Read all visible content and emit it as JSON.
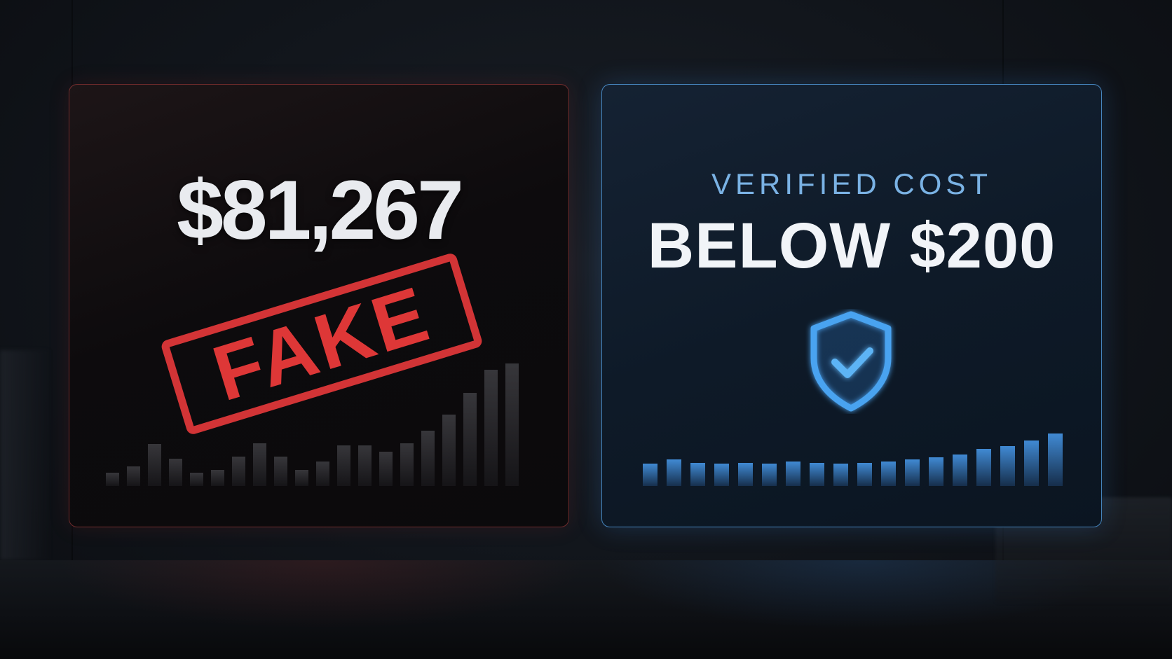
{
  "left_panel": {
    "amount": "$81,267",
    "stamp_text": "FAKE",
    "accent_color": "#e2383a",
    "bar_levels": [
      0.11,
      0.16,
      0.34,
      0.22,
      0.11,
      0.13,
      0.24,
      0.35,
      0.24,
      0.13,
      0.2,
      0.33,
      0.33,
      0.28,
      0.35,
      0.45,
      0.58,
      0.76,
      0.95,
      1.0
    ]
  },
  "right_panel": {
    "label": "VERIFIED COST",
    "amount": "BELOW $200",
    "icon": "shield-check-icon",
    "accent_color": "#4aa3f0",
    "bar_levels": [
      0.42,
      0.5,
      0.44,
      0.42,
      0.44,
      0.42,
      0.46,
      0.44,
      0.42,
      0.44,
      0.46,
      0.5,
      0.54,
      0.6,
      0.7,
      0.76,
      0.86,
      1.0
    ]
  }
}
